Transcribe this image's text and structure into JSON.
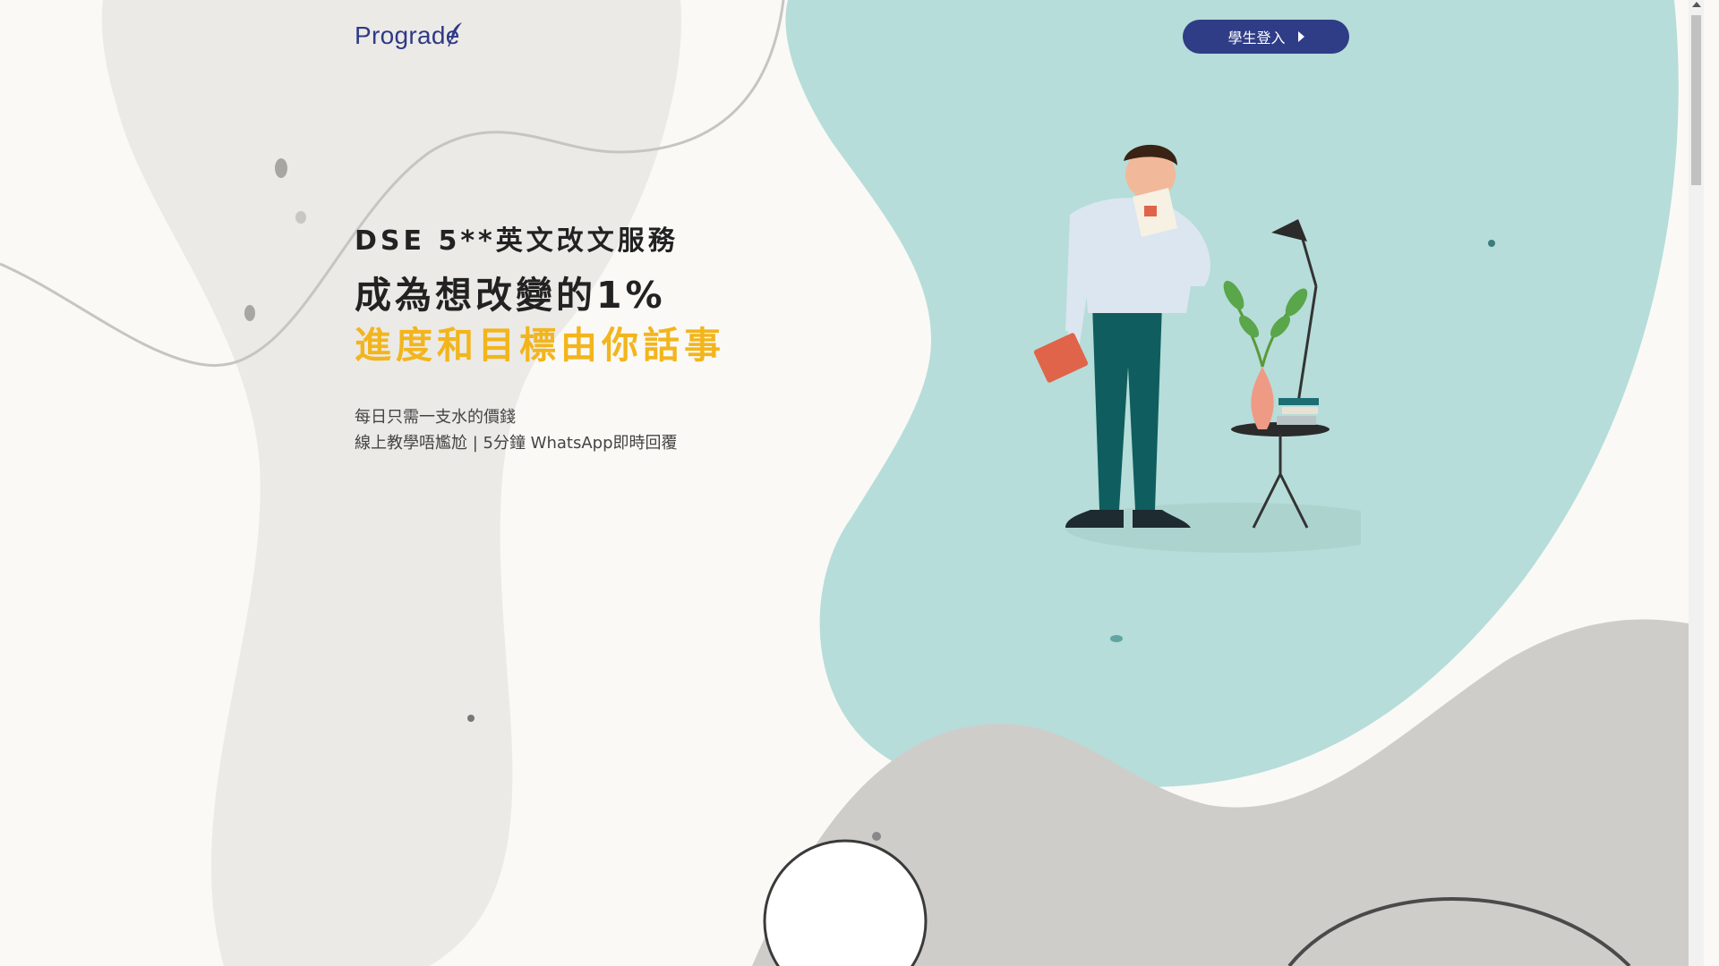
{
  "header": {
    "logo_text": "Prograde",
    "login_label": "學生登入"
  },
  "hero": {
    "subtitle": "DSE 5**英文改文服務",
    "title_line1": "成為想改變的1%",
    "title_line2": "進度和目標由你話事",
    "desc_line1": "每日只需一支水的價錢",
    "desc_line2": "線上教學唔尷尬 | 5分鐘 WhatsApp即時回覆"
  },
  "colors": {
    "brand_navy": "#2e3d86",
    "accent_yellow": "#f2b51c",
    "teal_blob": "#b6ddd9",
    "grey_blob": "#cfcdca"
  },
  "icons": {
    "login_arrow": "caret-right-icon",
    "logo_mark": "feather-icon"
  }
}
